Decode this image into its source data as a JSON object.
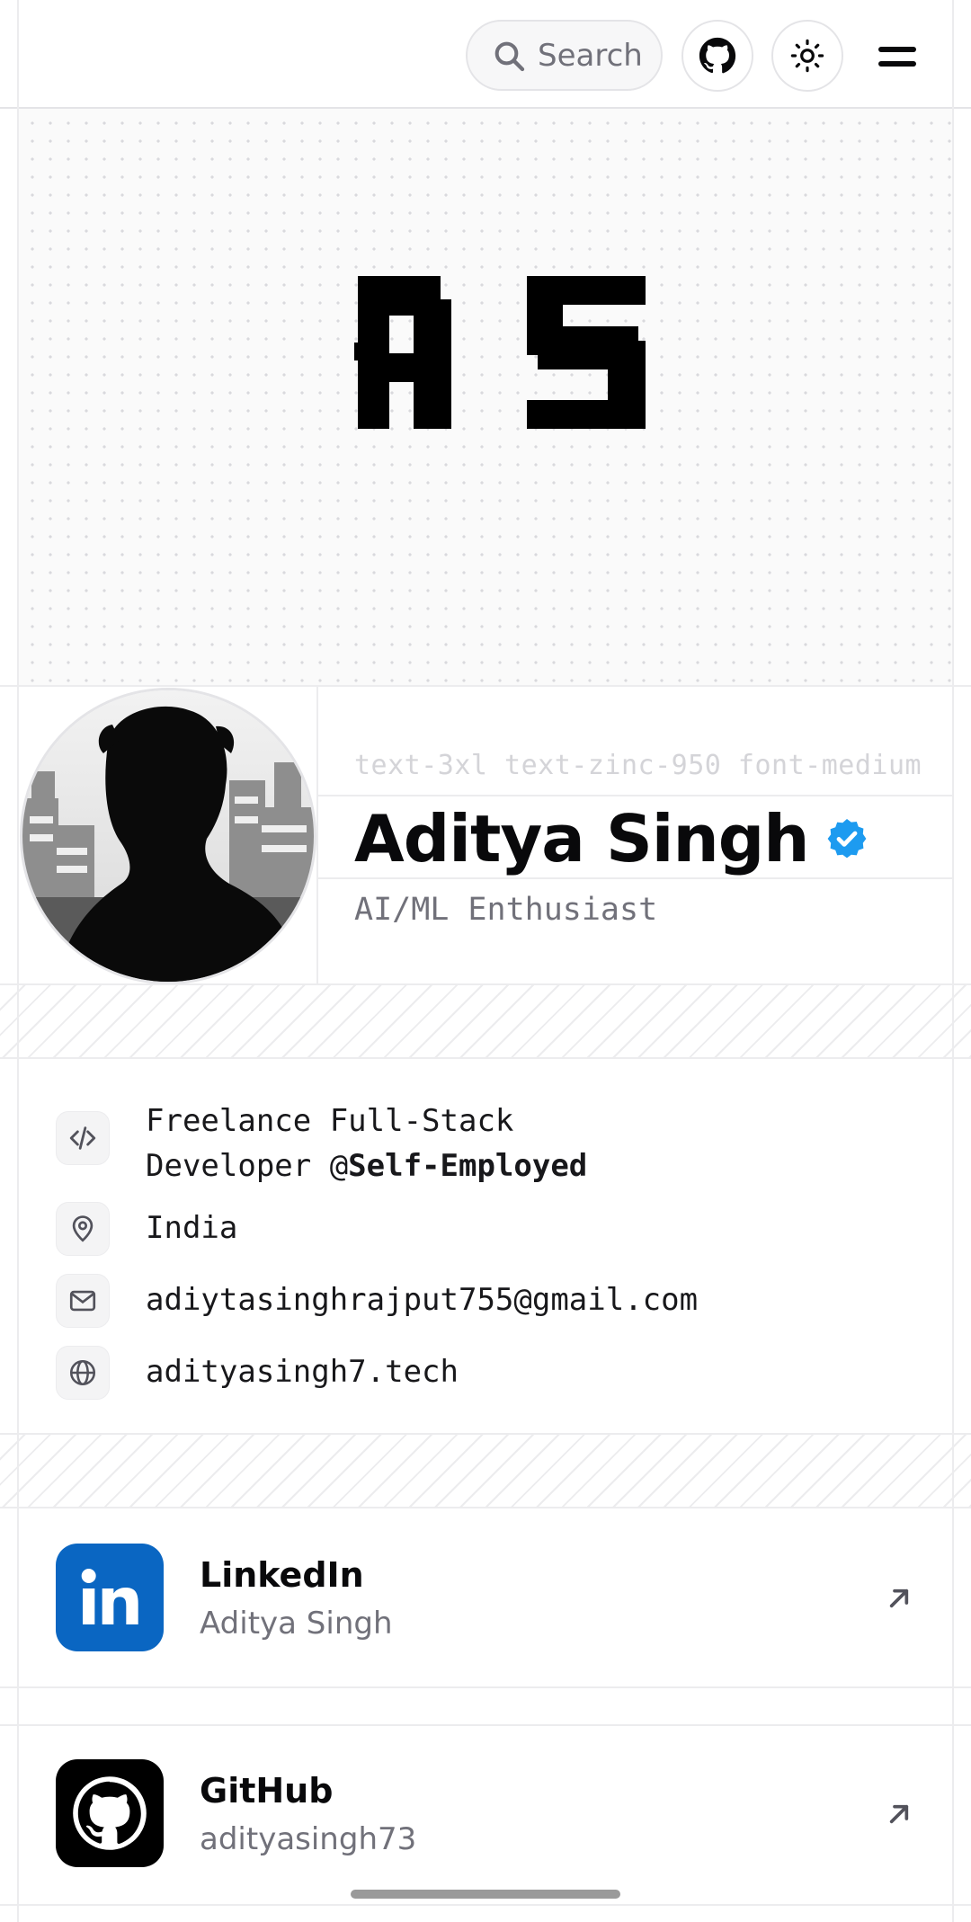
{
  "header": {
    "search_label": "Search",
    "github_icon": "github-icon",
    "theme_icon": "sun-icon",
    "menu_icon": "menu-icon"
  },
  "banner": {
    "monogram": "AS"
  },
  "profile": {
    "class_hint": "text-3xl text-zinc-950 font-medium",
    "name": "Aditya Singh",
    "verified_icon": "verified-badge-icon",
    "tagline": "AI/ML Enthusiast"
  },
  "info": {
    "job_line1": "Freelance Full-Stack",
    "job_line2_prefix": "Developer @",
    "job_company": "Self-Employed",
    "location": "India",
    "email": "adiytasinghrajput755@gmail.com",
    "website": "adityasingh7.tech"
  },
  "social": [
    {
      "title": "LinkedIn",
      "handle": "Aditya Singh",
      "icon": "linkedin-icon",
      "color": "#0a66c2"
    },
    {
      "title": "GitHub",
      "handle": "adityasingh73",
      "icon": "github-icon",
      "color": "#000000"
    }
  ],
  "colors": {
    "accent_verified": "#1d9bf0",
    "border": "#e4e4e7",
    "muted_text": "#71717a"
  }
}
